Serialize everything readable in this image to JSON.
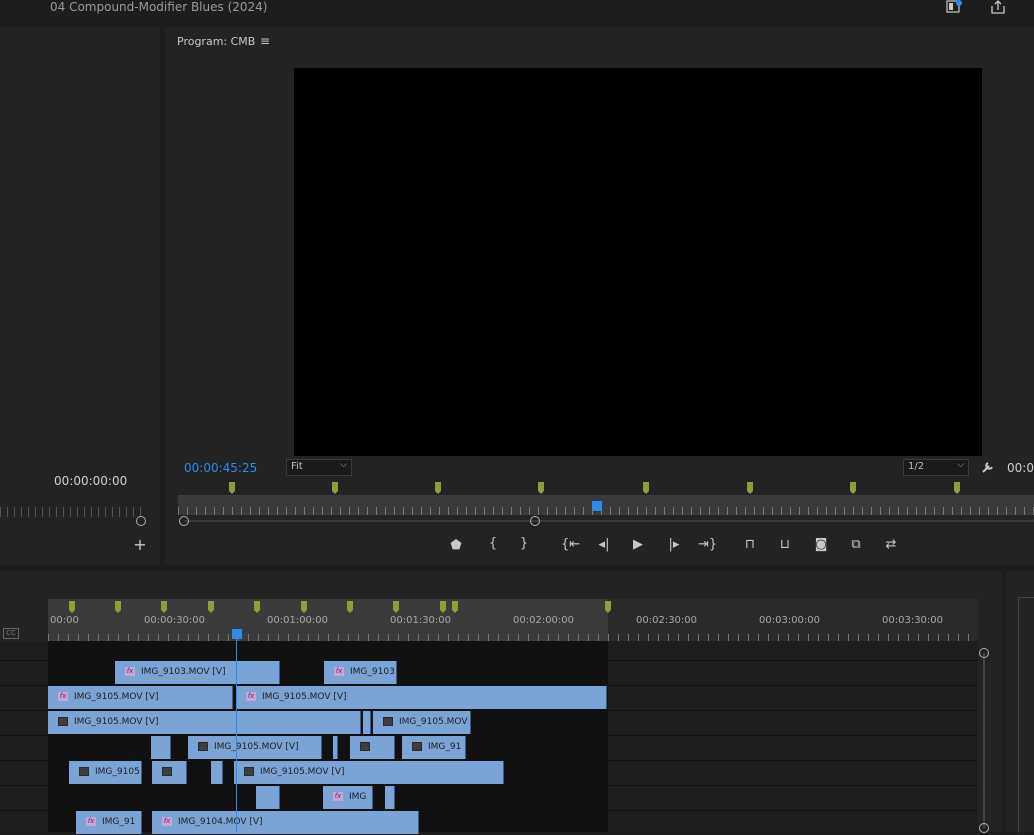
{
  "project_title": "04 Compound-Modifier Blues (2024)",
  "source_panel": {
    "timecode": "00:00:00:00"
  },
  "program": {
    "title": "Program: CMB",
    "timecode": "00:00:45:25",
    "zoom": "Fit",
    "resolution": "1/2",
    "duration_partial": "00:0"
  },
  "timeline": {
    "ruler_labels": [
      "00:00",
      "00:00:30:00",
      "00:01:00:00",
      "00:01:30:00",
      "00:02:00:00",
      "00:02:30:00",
      "00:03:00:00",
      "00:03:30:00"
    ],
    "clips": [
      {
        "label": "IMG_9103.MOV [V]",
        "badge": "fx"
      },
      {
        "label": "IMG_9103",
        "badge": "fx"
      },
      {
        "label": "IMG_9105.MOV [V]",
        "badge": "fx"
      },
      {
        "label": "IMG_9105.MOV [V]",
        "badge": "fx"
      },
      {
        "label": "IMG_9105.MOV [V]",
        "badge": "img"
      },
      {
        "label": "",
        "badge": "none"
      },
      {
        "label": "IMG_9105.MOV",
        "badge": "img"
      },
      {
        "label": "",
        "badge": "none"
      },
      {
        "label": "IMG_9105.MOV [V]",
        "badge": "img"
      },
      {
        "label": "",
        "badge": "none"
      },
      {
        "label": "",
        "badge": "img"
      },
      {
        "label": "IMG_91",
        "badge": "img"
      },
      {
        "label": "IMG_9105",
        "badge": "img"
      },
      {
        "label": "",
        "badge": "img"
      },
      {
        "label": "",
        "badge": "none"
      },
      {
        "label": "IMG_9105.MOV [V]",
        "badge": "img"
      },
      {
        "label": "",
        "badge": "none"
      },
      {
        "label": "IMG",
        "badge": "fx"
      },
      {
        "label": "",
        "badge": "none"
      },
      {
        "label": "IMG_91",
        "badge": "fx"
      },
      {
        "label": "IMG_9104.MOV [V]",
        "badge": "fx"
      }
    ]
  }
}
